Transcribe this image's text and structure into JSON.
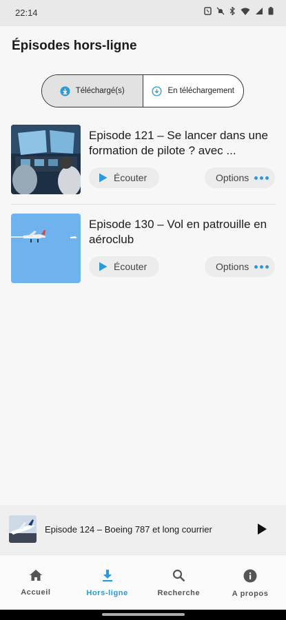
{
  "status_bar": {
    "time": "22:14"
  },
  "header": {
    "title": "Épisodes hors-ligne"
  },
  "tabs": [
    {
      "label": "Téléchargé(s)",
      "active": true
    },
    {
      "label": "En téléchargement",
      "active": false
    }
  ],
  "episodes": [
    {
      "title": "Episode 121 – Se lancer dans une formation de pilote ? avec ...",
      "listen_label": "Écouter",
      "options_label": "Options"
    },
    {
      "title": "Episode 130 – Vol en patrouille en aéroclub",
      "listen_label": "Écouter",
      "options_label": "Options"
    }
  ],
  "mini_player": {
    "title": "Episode 124 – Boeing 787 et long courrier"
  },
  "bottom_nav": [
    {
      "label": "Accueil",
      "icon": "home-icon",
      "active": false
    },
    {
      "label": "Hors-ligne",
      "icon": "download-icon",
      "active": true
    },
    {
      "label": "Recherche",
      "icon": "search-icon",
      "active": false
    },
    {
      "label": "A propos",
      "icon": "info-icon",
      "active": false
    }
  ],
  "colors": {
    "accent": "#2a9ad8",
    "text": "#1b1b1b",
    "chip_bg": "#ececec"
  }
}
